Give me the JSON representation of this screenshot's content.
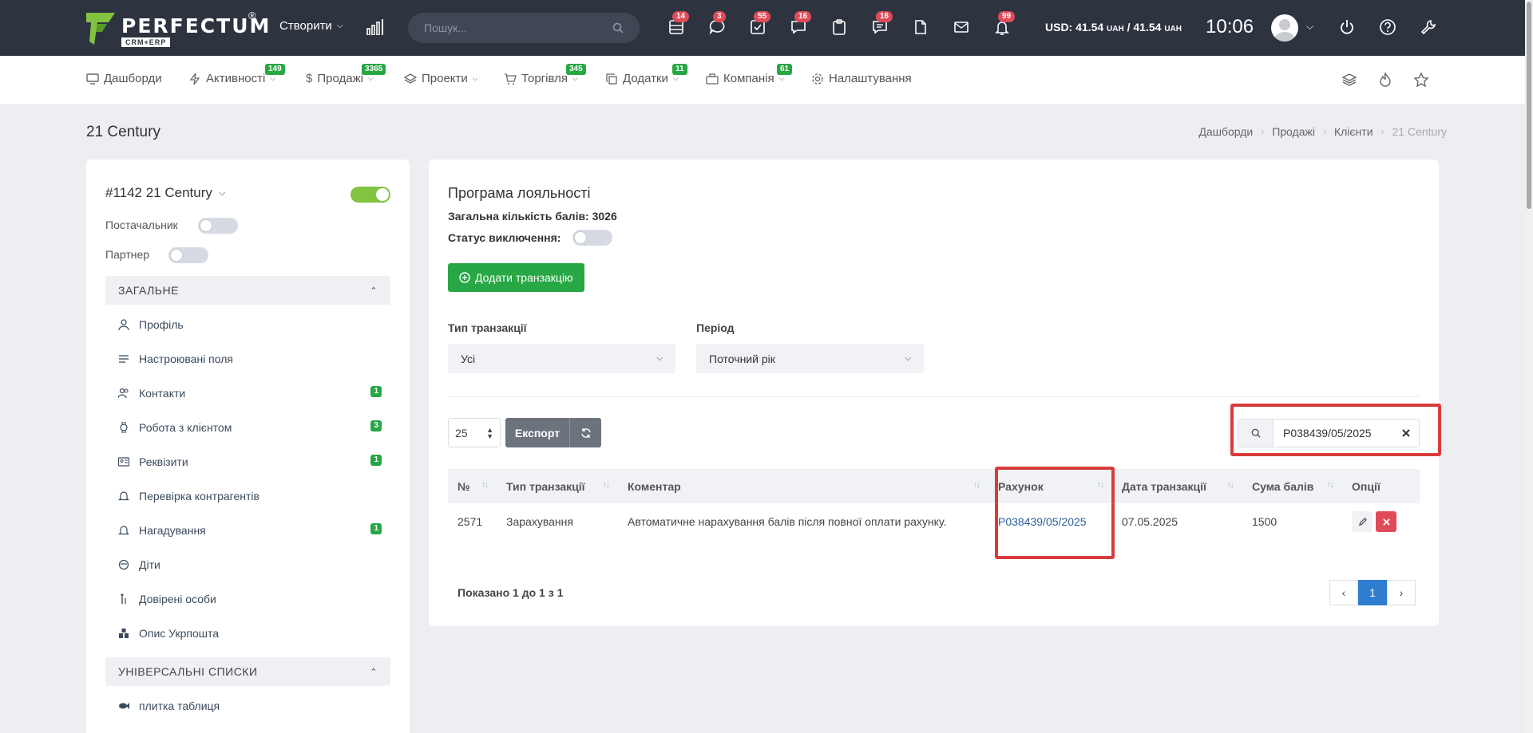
{
  "topbar": {
    "logo_text": "PERFECTUM",
    "logo_reg": "®",
    "logo_sub": "CRM+ERP",
    "create_label": "Створити",
    "search_placeholder": "Пошук...",
    "icons": [
      {
        "name": "tasks-list-icon",
        "badge": "14"
      },
      {
        "name": "chat-icon",
        "badge": "3"
      },
      {
        "name": "checkbox-icon",
        "badge": "55"
      },
      {
        "name": "comments-icon",
        "badge": "16"
      },
      {
        "name": "clipboard-icon",
        "badge": ""
      },
      {
        "name": "messages-icon",
        "badge": "16"
      },
      {
        "name": "document-icon",
        "badge": ""
      },
      {
        "name": "mail-icon",
        "badge": ""
      },
      {
        "name": "bell-icon",
        "badge": "99"
      }
    ],
    "currency_prefix": "USD: 41.54",
    "currency_unit": "UAH",
    "currency_mid": "/ 41.54",
    "time": "10:06"
  },
  "nav": {
    "items": [
      {
        "label": "Дашборди",
        "badge": ""
      },
      {
        "label": "Активності",
        "badge": "149"
      },
      {
        "label": "Продажі",
        "badge": "3365"
      },
      {
        "label": "Проекти",
        "badge": ""
      },
      {
        "label": "Торгівля",
        "badge": "345"
      },
      {
        "label": "Додатки",
        "badge": "11"
      },
      {
        "label": "Компанія",
        "badge": "61"
      },
      {
        "label": "Налаштування",
        "badge": ""
      }
    ]
  },
  "page": {
    "title": "21 Century",
    "breadcrumb": [
      "Дашборди",
      "Продажі",
      "Клієнти",
      "21 Century"
    ]
  },
  "client": {
    "title": "#1142 21 Century",
    "supplier_label": "Постачальник",
    "partner_label": "Партнер",
    "section_general": "ЗАГАЛЬНЕ",
    "section_universal": "УНІВЕРСАЛЬНІ СПИСКИ",
    "menu": [
      {
        "label": "Профіль",
        "badge": ""
      },
      {
        "label": "Настроювані поля",
        "badge": ""
      },
      {
        "label": "Контакти",
        "badge": "1"
      },
      {
        "label": "Робота з клієнтом",
        "badge": "3"
      },
      {
        "label": "Реквізити",
        "badge": "1"
      },
      {
        "label": "Перевірка контрагентів",
        "badge": ""
      },
      {
        "label": "Нагадування",
        "badge": "1"
      },
      {
        "label": "Діти",
        "badge": ""
      },
      {
        "label": "Довірені особи",
        "badge": ""
      },
      {
        "label": "Опис Укрпошта",
        "badge": ""
      }
    ],
    "universal_item": "плитка таблиця"
  },
  "loyalty": {
    "title": "Програма лояльності",
    "total_points": "Загальна кількість балів: 3026",
    "exclusion_status": "Статус виключення:",
    "add_button": "Додати транзакцію",
    "filter_type_label": "Тип транзакції",
    "filter_type_value": "Усі",
    "filter_period_label": "Період",
    "filter_period_value": "Поточний рік",
    "per_page": "25",
    "export_label": "Експорт",
    "search_value": "P038439/05/2025",
    "columns": [
      "№",
      "Тип транзакції",
      "Коментар",
      "Рахунок",
      "Дата транзакції",
      "Сума балів",
      "Опції"
    ],
    "rows": [
      {
        "no": "2571",
        "type": "Зарахування",
        "comment": "Автоматичне нарахування балів після повної оплати рахунку.",
        "invoice": "P038439/05/2025",
        "date": "07.05.2025",
        "sum": "1500"
      }
    ],
    "shown_text": "Показано 1 до 1 з 1",
    "current_page": "1"
  }
}
